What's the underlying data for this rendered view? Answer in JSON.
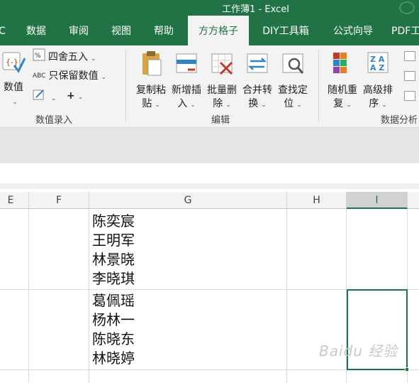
{
  "window": {
    "title": "工作薄1  -  Excel"
  },
  "tabs": [
    {
      "label": "C",
      "active": false
    },
    {
      "label": "数据",
      "active": false
    },
    {
      "label": "审阅",
      "active": false
    },
    {
      "label": "视图",
      "active": false
    },
    {
      "label": "帮助",
      "active": false
    },
    {
      "label": "方方格子",
      "active": true
    },
    {
      "label": "DIY工具箱",
      "active": false
    },
    {
      "label": "公式向导",
      "active": false
    },
    {
      "label": "PDF工",
      "active": false
    }
  ],
  "ribbon": {
    "data_entry": {
      "group_label": "数值录入",
      "numeric_button": "数值",
      "round_label": "四舍五入",
      "keep_values_label": "只保留数值",
      "plus": "+"
    },
    "edit": {
      "group_label": "编辑",
      "copy_paste": [
        "复制粘",
        "贴"
      ],
      "add_insert": [
        "新增插",
        "入"
      ],
      "batch_delete": [
        "批量删",
        "除"
      ],
      "merge_convert": [
        "合并转",
        "换"
      ],
      "find_locate": [
        "查找定",
        "位"
      ]
    },
    "analysis": {
      "group_label": "数据分析",
      "random_repeat": [
        "随机重",
        "复"
      ],
      "advanced_sort": [
        "高级排",
        "序"
      ]
    }
  },
  "sheet": {
    "columns": [
      "E",
      "F",
      "G",
      "H",
      "I"
    ],
    "selected_column": "I",
    "cell_g1": [
      "陈奕宸",
      "王明军",
      "林景晓",
      "李晓琪"
    ],
    "cell_g2": [
      "葛佩瑶",
      "杨林一",
      "陈晓东",
      "林晓婷"
    ]
  },
  "watermark": "Baidu 经验",
  "colors": {
    "accent": "#217346",
    "ribbon_bg": "#f3f3f3"
  }
}
